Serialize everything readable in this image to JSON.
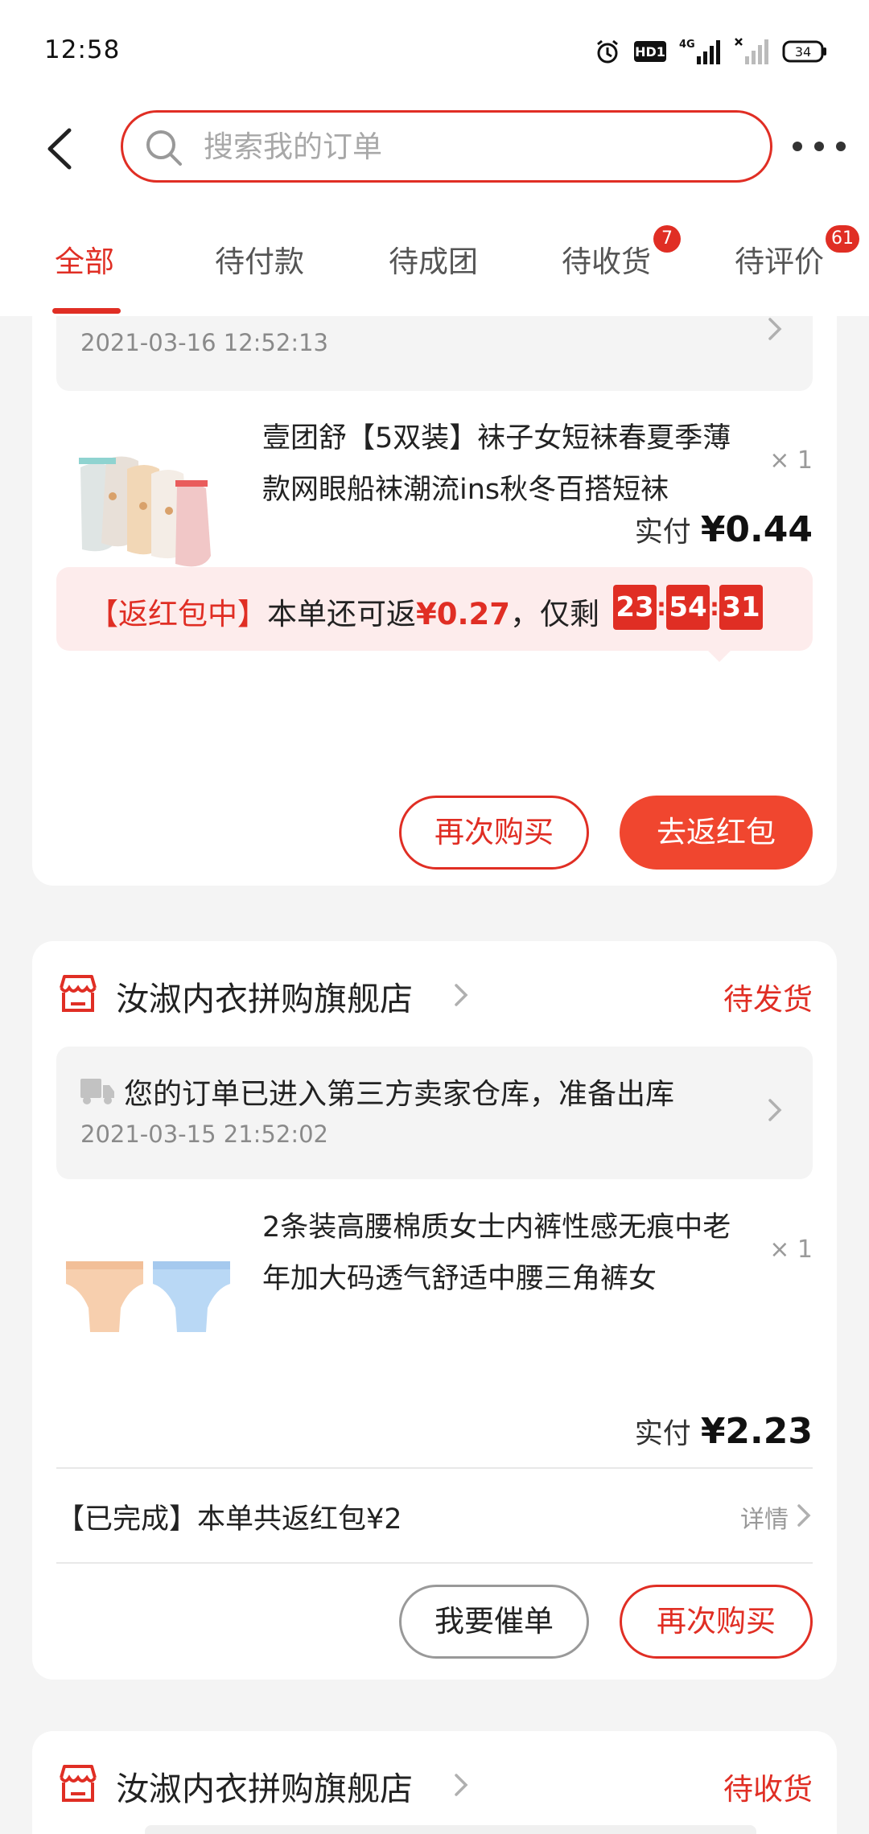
{
  "status_bar": {
    "time": "12:58",
    "hd_label": "HD1",
    "network_label": "4G",
    "battery": "34"
  },
  "header": {
    "search_placeholder": "搜索我的订单"
  },
  "tabs": [
    {
      "label": "全部",
      "active": true
    },
    {
      "label": "待付款"
    },
    {
      "label": "待成团"
    },
    {
      "label": "待收货",
      "badge": "7"
    },
    {
      "label": "待评价",
      "badge": "61"
    }
  ],
  "orders": [
    {
      "logistics_date": "2021-03-16 12:52:13",
      "product_title": "壹团舒【5双装】袜子女短袜春夏季薄款网眼船袜潮流ins秋冬百搭短袜",
      "quantity": "× 1",
      "paid_label": "实付",
      "paid_amount": "¥0.44",
      "refund": {
        "tag": "【返红包中】",
        "text": "本单还可返",
        "amount": "¥0.27",
        "remaining": "，仅剩",
        "hours": "23",
        "minutes": "54",
        "seconds": "31"
      },
      "buttons": {
        "rebuy": "再次购买",
        "redpacket": "去返红包"
      }
    },
    {
      "store_name": "汝淑内衣拼购旗舰店",
      "status": "待发货",
      "logistics_title": "您的订单已进入第三方卖家仓库，准备出库",
      "logistics_date": "2021-03-15 21:52:02",
      "product_title": "2条装高腰棉质女士内裤性感无痕中老年加大码透气舒适中腰三角裤女",
      "quantity": "× 1",
      "paid_label": "实付",
      "paid_amount": "¥2.23",
      "completed_text": "【已完成】本单共返红包¥2",
      "detail_label": "详情",
      "buttons": {
        "urge": "我要催单",
        "rebuy": "再次购买"
      }
    },
    {
      "store_name": "汝淑内衣拼购旗舰店",
      "status": "待收货"
    }
  ],
  "colors": {
    "accent": "#e02e24",
    "accent_button": "#f0462f"
  }
}
